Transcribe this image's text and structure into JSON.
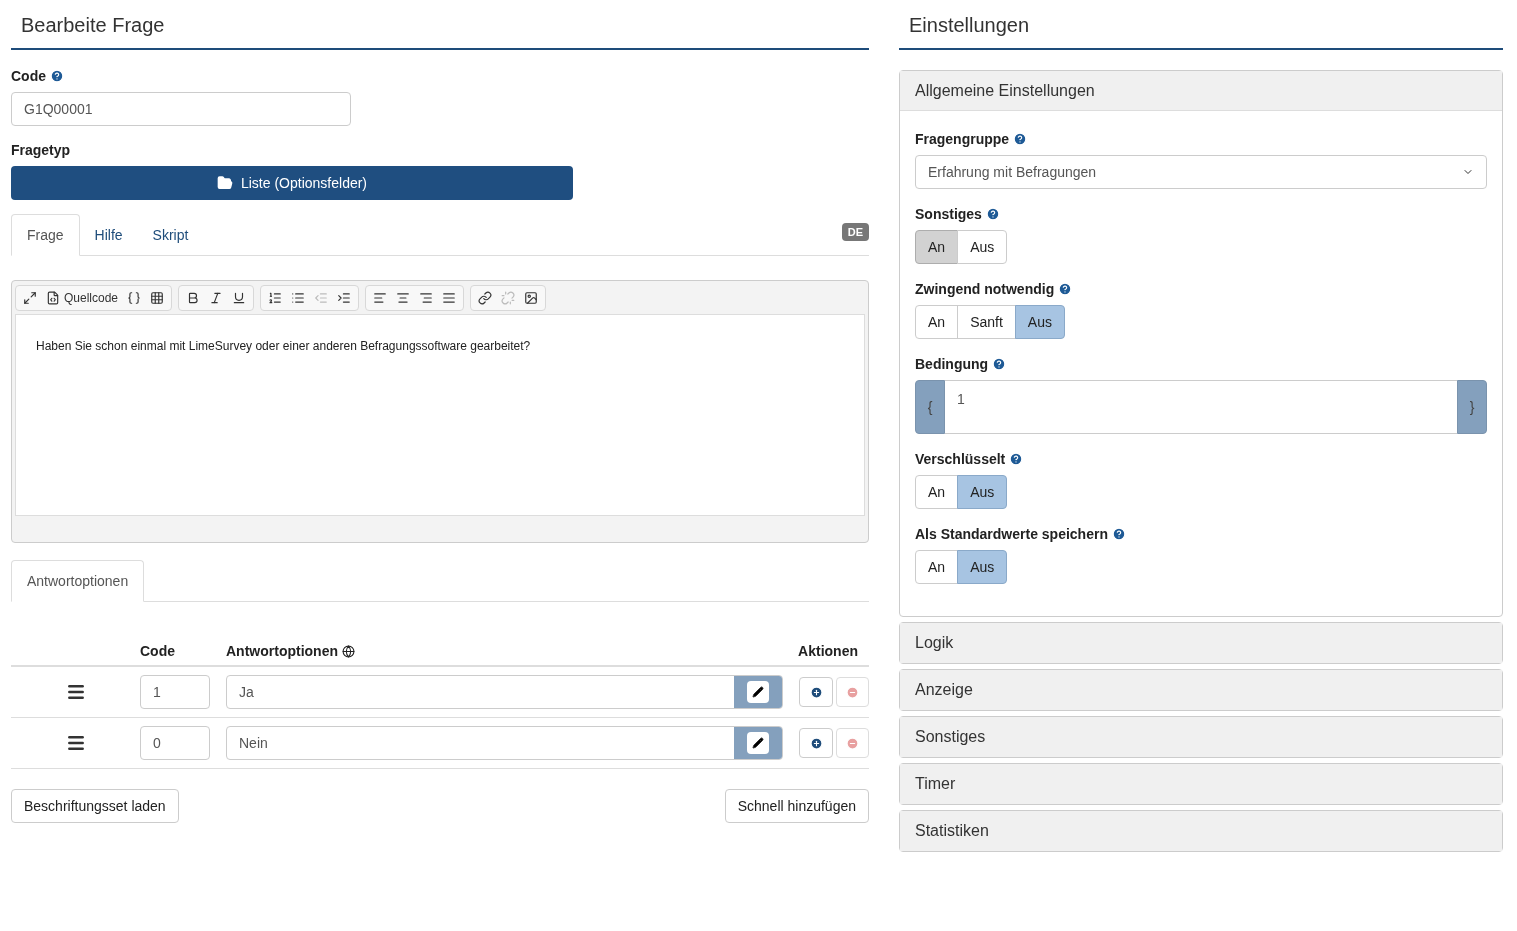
{
  "left": {
    "title": "Bearbeite Frage",
    "code": {
      "label": "Code",
      "value": "G1Q00001"
    },
    "question_type": {
      "label": "Fragetyp",
      "button": "Liste (Optionsfelder)"
    },
    "tabs": [
      {
        "label": "Frage",
        "selected": true
      },
      {
        "label": "Hilfe",
        "selected": false
      },
      {
        "label": "Skript",
        "selected": false
      }
    ],
    "language_badge": "DE",
    "toolbar": [
      [
        {
          "disabled": false
        },
        {
          "disabled": false,
          "label": "Quellcode"
        },
        {
          "disabled": false
        },
        {
          "disabled": false
        }
      ],
      [
        {
          "disabled": false
        },
        {
          "disabled": false
        },
        {
          "disabled": false
        }
      ],
      [
        {
          "disabled": false
        },
        {
          "disabled": false
        },
        {
          "disabled": true
        },
        {
          "disabled": false
        }
      ],
      [
        {
          "disabled": false
        },
        {
          "disabled": false
        },
        {
          "disabled": false
        },
        {
          "disabled": false
        }
      ],
      [
        {
          "disabled": false
        },
        {
          "disabled": true
        },
        {
          "disabled": false
        }
      ]
    ],
    "editor_text": "Haben Sie schon einmal mit LimeSurvey oder einer anderen Befragungssoftware gearbeitet?",
    "answer_tabs": [
      {
        "label": "Antwortoptionen",
        "selected": true
      }
    ],
    "answers": {
      "columns": [
        "Code",
        "Antwortoptionen",
        "Aktionen"
      ],
      "rows": [
        {
          "code": "1",
          "label": "Ja"
        },
        {
          "code": "0",
          "label": "Nein"
        }
      ]
    },
    "buttons": [
      "Beschriftungsset laden",
      "Schnell hinzufügen"
    ]
  },
  "right": {
    "title": "Einstellungen",
    "panels": [
      {
        "title": "Allgemeine Einstellungen",
        "expanded": true,
        "fields": [
          {
            "kind": "select",
            "label": "Fragengruppe",
            "value": "Erfahrung mit Befragungen"
          },
          {
            "kind": "choice",
            "label": "Sonstiges",
            "options": [
              {
                "label": "An",
                "selected": true
              },
              {
                "label": "Aus",
                "selected": false
              }
            ]
          },
          {
            "kind": "toggle",
            "label": "Zwingend notwendig",
            "options": [
              {
                "label": "An",
                "selected": false
              },
              {
                "label": "Sanft",
                "selected": false
              },
              {
                "label": "Aus",
                "selected": true
              }
            ]
          },
          {
            "kind": "expression",
            "label": "Bedingung",
            "open": "{",
            "value": "1",
            "close": "}"
          },
          {
            "kind": "toggle",
            "label": "Verschlüsselt",
            "options": [
              {
                "label": "An",
                "selected": false
              },
              {
                "label": "Aus",
                "selected": true
              }
            ]
          },
          {
            "kind": "toggle",
            "label": "Als Standardwerte speichern",
            "options": [
              {
                "label": "An",
                "selected": false
              },
              {
                "label": "Aus",
                "selected": true
              }
            ]
          }
        ]
      },
      {
        "title": "Logik",
        "expanded": false
      },
      {
        "title": "Anzeige",
        "expanded": false
      },
      {
        "title": "Sonstiges",
        "expanded": false
      },
      {
        "title": "Timer",
        "expanded": false
      },
      {
        "title": "Statistiken",
        "expanded": false
      }
    ]
  }
}
